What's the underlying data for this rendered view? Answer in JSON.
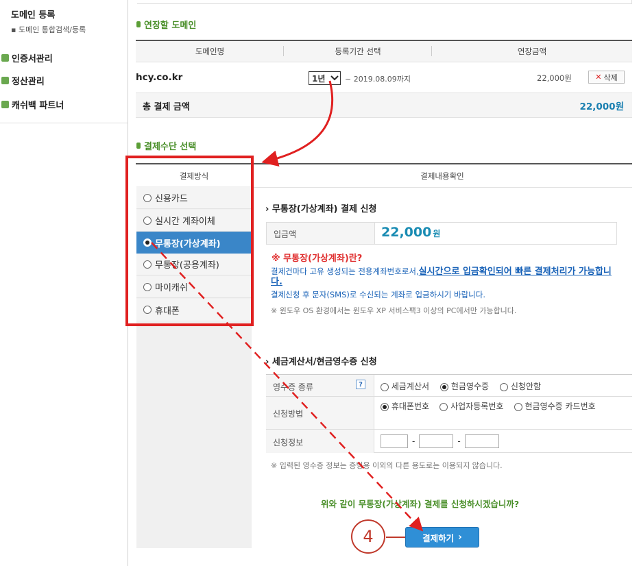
{
  "sidebar": {
    "domain_register": "도메인 등록",
    "domain_search": "▪ 도메인 통합검색/등록",
    "items": [
      {
        "label": "인증서관리"
      },
      {
        "label": "정산관리"
      },
      {
        "label": "캐쉬백 파트너"
      }
    ]
  },
  "renew_section": {
    "title": "연장할 도메인",
    "columns": [
      "도메인명",
      "등록기간 선택",
      "연장금액"
    ],
    "row": {
      "domain": "hcy.co.kr",
      "period": "1년",
      "until": "~ 2019.08.09까지",
      "amount": "22,000원",
      "delete_label": "삭제",
      "delete_icon": "x-icon"
    },
    "total_label": "총 결제 금액",
    "total_value": "22,000원"
  },
  "payment_section": {
    "title": "결제수단 선택",
    "col_method": "결제방식",
    "col_confirm": "결제내용확인",
    "methods": [
      {
        "label": "신용카드",
        "selected": false
      },
      {
        "label": "실시간 계좌이체",
        "selected": false
      },
      {
        "label": "무통장(가상계좌)",
        "selected": true
      },
      {
        "label": "무통장(공용계좌)",
        "selected": false
      },
      {
        "label": "마이캐쉬",
        "selected": false
      },
      {
        "label": "휴대폰",
        "selected": false
      }
    ]
  },
  "virtual_account": {
    "heading": "무통장(가상계좌) 결제 신청",
    "amount_label": "입금액",
    "amount_value": "22,000",
    "amount_unit": "원",
    "what_is": "※ 무통장(가상계좌)란?",
    "desc_prefix": "결제건마다 고유 생성되는 전용계좌번호로서,",
    "desc_emph": "실시간으로 입금확인되어 빠른 결제처리가 가능합니다.",
    "desc_line2": "결제신청 후 문자(SMS)로 수신되는 계좌로 입금하시기 바랍니다.",
    "note": "※ 윈도우 OS 환경에서는 윈도우 XP 서비스팩3 이상의 PC에서만 가능합니다."
  },
  "tax_section": {
    "heading": "세금계산서/현금영수증 신청",
    "receipt_type_label": "영수증 종류",
    "help_icon": "?",
    "receipt_options": [
      {
        "label": "세금계산서",
        "selected": false
      },
      {
        "label": "현금영수증",
        "selected": true
      },
      {
        "label": "신청안함",
        "selected": false
      }
    ],
    "method_label": "신청방법",
    "method_options": [
      {
        "label": "휴대폰번호",
        "selected": true
      },
      {
        "label": "사업자등록번호",
        "selected": false
      },
      {
        "label": "현금영수증 카드번호",
        "selected": false
      }
    ],
    "info_label": "신청정보",
    "dash": "-",
    "note": "※ 입력된 영수증 정보는 증빙용 이외의 다른 용도로는 이용되지 않습니다."
  },
  "confirm": {
    "question": "위와 같이 무통장(가상계좌) 결제를 신청하시겠습니까?",
    "pay_button": "결제하기",
    "step_number": "4"
  },
  "colors": {
    "accent_green": "#4a8f2a",
    "blue_button": "#2f8fd6",
    "active_tab": "#3a86c8",
    "annotation_red": "#e02020"
  }
}
